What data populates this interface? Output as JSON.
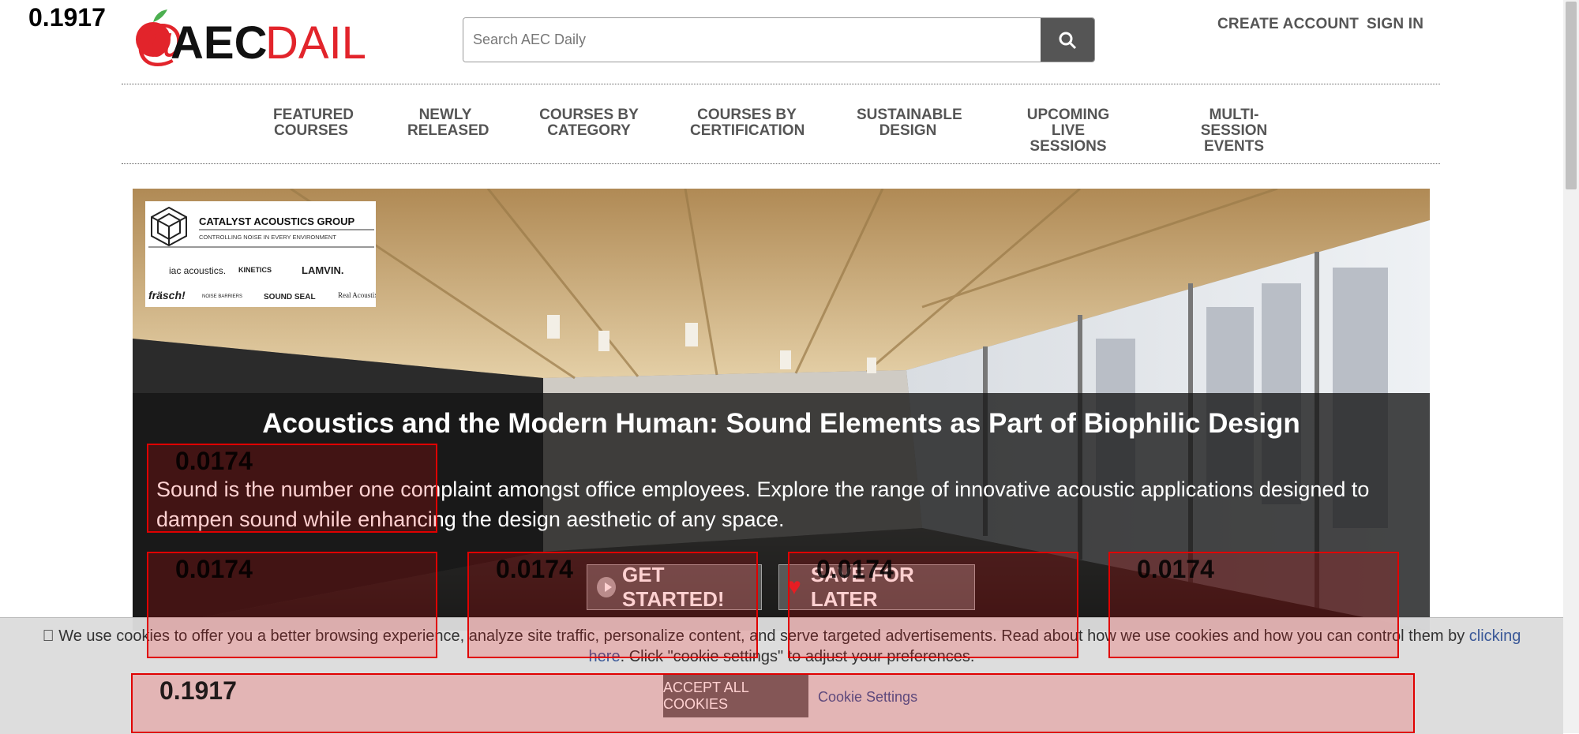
{
  "overlay": {
    "top_score": "0.1917",
    "box_score": "0.0174",
    "bottom_score": "0.1917"
  },
  "header": {
    "search_placeholder": "Search AEC Daily",
    "create_account": "CREATE ACCOUNT",
    "sign_in": "SIGN IN",
    "logo_text": "@AECDAILY."
  },
  "nav": [
    {
      "line1": "FEATURED",
      "line2": "COURSES"
    },
    {
      "line1": "NEWLY",
      "line2": "RELEASED"
    },
    {
      "line1": "COURSES BY",
      "line2": "CATEGORY"
    },
    {
      "line1": "COURSES BY",
      "line2": "CERTIFICATION"
    },
    {
      "line1": "SUSTAINABLE",
      "line2": "DESIGN"
    },
    {
      "line1": "UPCOMING",
      "line2": "LIVE SESSIONS"
    },
    {
      "line1": "MULTI-SESSION",
      "line2": "EVENTS"
    }
  ],
  "hero": {
    "title": "Acoustics and the Modern Human: Sound Elements as Part of Biophilic Design",
    "description": "Sound is the number one complaint amongst office employees. Explore the range of innovative acoustic applications designed to dampen sound while enhancing the design aesthetic of any space.",
    "get_started": "GET STARTED!",
    "save_later": "SAVE FOR LATER",
    "sponsor": {
      "name": "CATALYST ACOUSTICS GROUP",
      "tagline": "CONTROLLING NOISE IN EVERY ENVIRONMENT",
      "brands_row1": [
        "iac acoustics.",
        "KINETICS",
        "LAMVIN."
      ],
      "brands_row2": [
        "fräsch!",
        "NOISE BARRIERS",
        "SOUND SEAL",
        "Real Acoustix"
      ]
    }
  },
  "cookie": {
    "text_before": "\u0000 We use cookies to offer you a better browsing experience, analyze site traffic, personalize content, and serve targeted advertisements. Read about how we use cookies and how you can control them by ",
    "link": "clicking here",
    "text_after": ". Click \"cookie settings\" to adjust your preferences.",
    "accept": "ACCEPT ALL COOKIES",
    "settings": "Cookie Settings"
  },
  "colors": {
    "brand_red": "#e2242b",
    "nav_grey": "#555555",
    "overlay_red": "#e00000"
  }
}
